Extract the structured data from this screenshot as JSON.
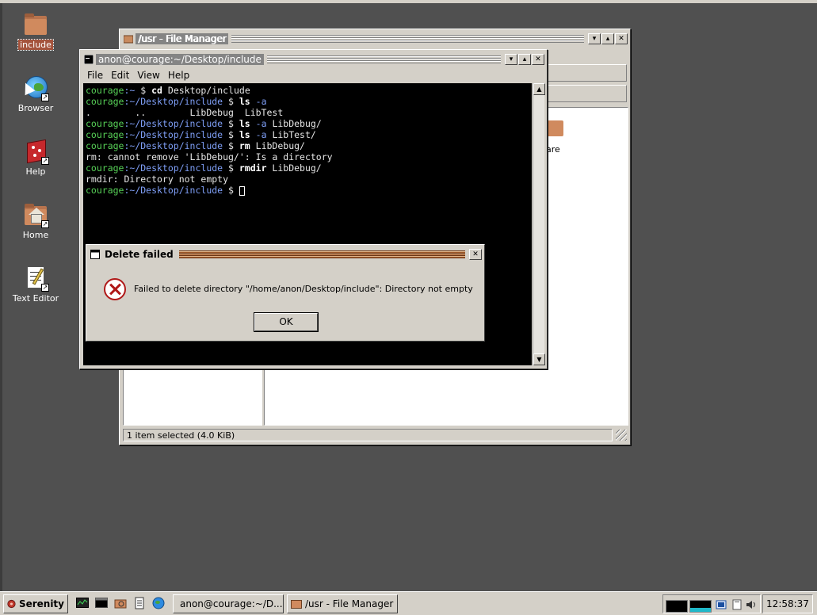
{
  "desktop": {
    "icons": [
      {
        "label": "include",
        "icon": "folder-icon"
      },
      {
        "label": "Browser",
        "icon": "globe-icon"
      },
      {
        "label": "Help",
        "icon": "help-book-icon"
      },
      {
        "label": "Home",
        "icon": "home-folder-icon"
      },
      {
        "label": "Text Editor",
        "icon": "text-editor-icon"
      }
    ]
  },
  "file_manager": {
    "title": "/usr - File Manager",
    "status": "1 item selected (4.0 KiB)",
    "partial_item_label": "are"
  },
  "terminal": {
    "title": "anon@courage:~/Desktop/include",
    "menu": [
      "File",
      "Edit",
      "View",
      "Help"
    ],
    "user": "courage",
    "lines": [
      {
        "path": "~",
        "cmd": "cd",
        "args": "Desktop/include"
      },
      {
        "path": "~/Desktop/include",
        "cmd": "ls",
        "opt": "-a",
        "args": ""
      },
      {
        "output": ".        ..        LibDebug  LibTest"
      },
      {
        "path": "~/Desktop/include",
        "cmd": "ls",
        "opt": "-a",
        "args": "LibDebug/"
      },
      {
        "path": "~/Desktop/include",
        "cmd": "ls",
        "opt": "-a",
        "args": "LibTest/"
      },
      {
        "path": "~/Desktop/include",
        "cmd": "rm",
        "args": "LibDebug/"
      },
      {
        "output": "rm: cannot remove 'LibDebug/': Is a directory"
      },
      {
        "path": "~/Desktop/include",
        "cmd": "rmdir",
        "args": "LibDebug/"
      },
      {
        "output": "rmdir: Directory not empty"
      },
      {
        "path": "~/Desktop/include",
        "cmd": "",
        "args": ""
      }
    ]
  },
  "dialog": {
    "title": "Delete failed",
    "message": "Failed to delete directory \"/home/anon/Desktop/include\": Directory not empty",
    "ok_label": "OK"
  },
  "taskbar": {
    "start_label": "Serenity",
    "tasks": [
      "anon@courage:~/D...",
      "/usr - File Manager"
    ],
    "clock": "12:58:37"
  },
  "colors": {
    "desktop": "#505050",
    "chrome": "#d4d0c8",
    "active_title": "#a05a2c",
    "prompt_user": "#57d057",
    "prompt_path": "#7f9ff7",
    "error_icon": "#b01818"
  }
}
